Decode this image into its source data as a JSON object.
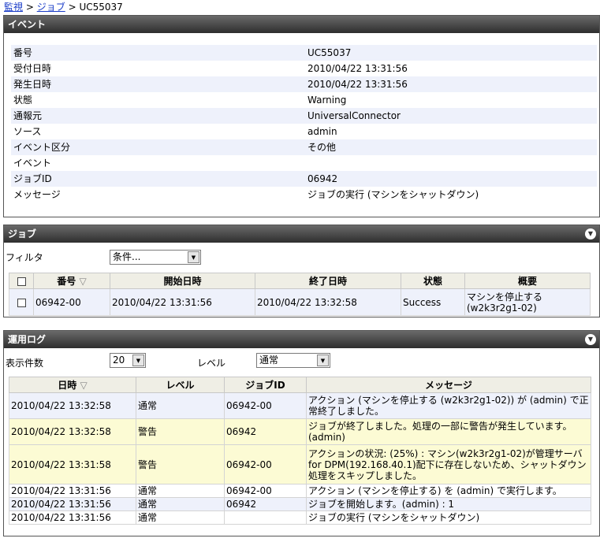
{
  "breadcrumb": {
    "root": "監視",
    "sep1": ">",
    "mid": "ジョブ",
    "sep2": ">",
    "current": "UC55037"
  },
  "event": {
    "title": "イベント",
    "rows": [
      {
        "label": "番号",
        "value": "UC55037"
      },
      {
        "label": "受付日時",
        "value": "2010/04/22 13:31:56"
      },
      {
        "label": "発生日時",
        "value": "2010/04/22 13:31:56"
      },
      {
        "label": "状態",
        "value": "Warning"
      },
      {
        "label": "通報元",
        "value": "UniversalConnector"
      },
      {
        "label": "ソース",
        "value": "admin"
      },
      {
        "label": "イベント区分",
        "value": "その他"
      },
      {
        "label": "イベント",
        "value": ""
      },
      {
        "label": "ジョブID",
        "value": "06942"
      },
      {
        "label": "メッセージ",
        "value": "ジョブの実行 (マシンをシャットダウン)"
      }
    ]
  },
  "job": {
    "title": "ジョブ",
    "filter_label": "フィルタ",
    "filter_value": "条件...",
    "columns": {
      "number": "番号",
      "start": "開始日時",
      "end": "終了日時",
      "status": "状態",
      "summary": "概要"
    },
    "sort_mark": "▽",
    "rows": [
      {
        "number": "06942-00",
        "start": "2010/04/22 13:31:56",
        "end": "2010/04/22 13:32:58",
        "status": "Success",
        "summary": "マシンを停止する (w2k3r2g1-02)"
      }
    ]
  },
  "log": {
    "title": "運用ログ",
    "count_label": "表示件数",
    "count_value": "20",
    "level_label": "レベル",
    "level_value": "通常",
    "columns": {
      "datetime": "日時",
      "level": "レベル",
      "jobid": "ジョブID",
      "message": "メッセージ"
    },
    "sort_mark": "▽",
    "rows": [
      {
        "datetime": "2010/04/22 13:32:58",
        "level": "通常",
        "jobid": "06942-00",
        "message": "アクション (マシンを停止する (w2k3r2g1-02)) が (admin) で正常終了しました。"
      },
      {
        "datetime": "2010/04/22 13:32:58",
        "level": "警告",
        "jobid": "06942",
        "message": "ジョブが終了しました。処理の一部に警告が発生しています。(admin)"
      },
      {
        "datetime": "2010/04/22 13:31:58",
        "level": "警告",
        "jobid": "06942-00",
        "message": "アクションの状況: (25%) : マシン(w2k3r2g1-02)が管理サーバfor DPM(192.168.40.1)配下に存在しないため、シャットダウン処理をスキップしました。"
      },
      {
        "datetime": "2010/04/22 13:31:56",
        "level": "通常",
        "jobid": "06942-00",
        "message": "アクション (マシンを停止する) を (admin) で実行します。"
      },
      {
        "datetime": "2010/04/22 13:31:56",
        "level": "通常",
        "jobid": "06942",
        "message": "ジョブを開始します。(admin) : 1"
      },
      {
        "datetime": "2010/04/22 13:31:56",
        "level": "通常",
        "jobid": "",
        "message": "ジョブの実行 (マシンをシャットダウン)"
      }
    ]
  },
  "icons": {
    "collapse": "collapse-arrow-icon",
    "dropdown": "chevron-down-icon"
  },
  "colors": {
    "header_dark": "#2e2e2e",
    "row_blue": "#eef1fb",
    "row_yellow": "#fcfbd4",
    "table_head": "#efeee5",
    "link": "#1a3cc8"
  }
}
